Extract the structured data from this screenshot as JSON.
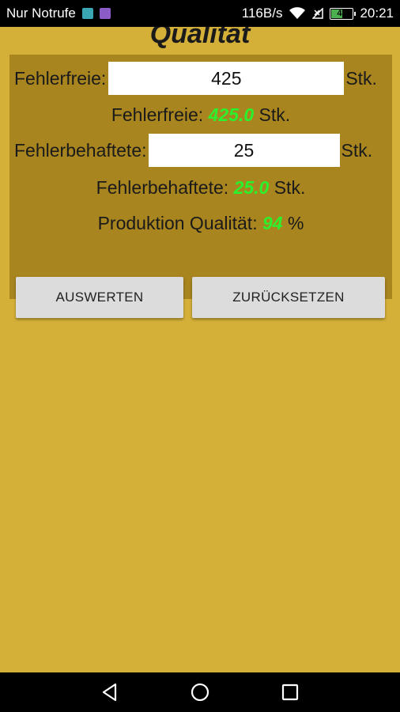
{
  "status_bar": {
    "carrier": "Nur Notrufe",
    "speed": "116B/s",
    "battery": "47",
    "time": "20:21"
  },
  "app": {
    "title": "Qualität",
    "good": {
      "label": "Fehlerfreie:",
      "value": "425",
      "unit": "Stk.",
      "result_label": "Fehlerfreie:",
      "result_value": "425.0",
      "result_unit": "Stk."
    },
    "bad": {
      "label": "Fehlerbehaftete:",
      "value": "25",
      "unit": "Stk.",
      "result_label": "Fehlerbehaftete:",
      "result_value": "25.0",
      "result_unit": "Stk."
    },
    "quality": {
      "label": "Produktion Qualität:",
      "value": "94",
      "unit": "%"
    },
    "buttons": {
      "evaluate": "AUSWERTEN",
      "reset": "ZURÜCKSETZEN"
    }
  },
  "colors": {
    "background": "#d4b038",
    "panel": "#a8851f",
    "result_value": "#2cf02c"
  }
}
